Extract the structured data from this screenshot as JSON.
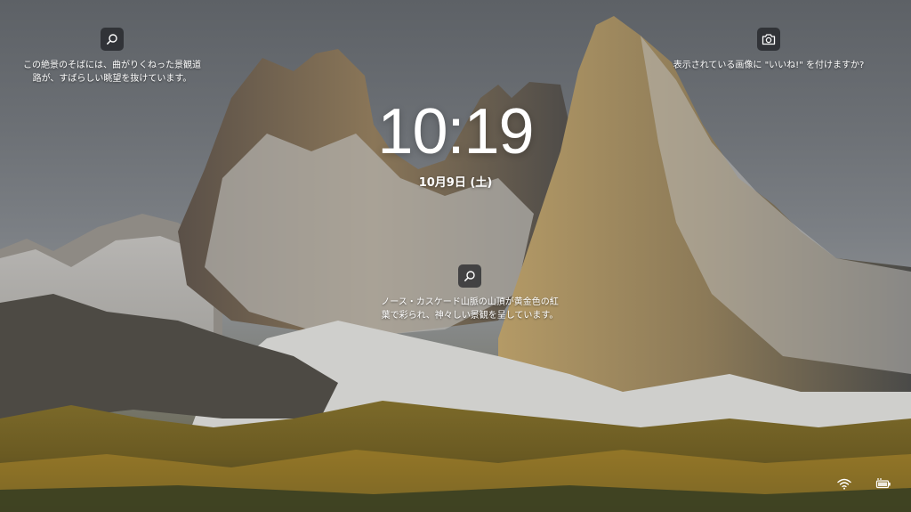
{
  "lockscreen": {
    "time": "10:19",
    "date": "10月9日 (土)"
  },
  "spotlight": {
    "left_caption": "この絶景のそばには、曲がりくねった景観道\n路が、すばらしい眺望を抜けています。",
    "center_caption": "ノース・カスケード山脈の山頂が黄金色の紅\n葉で彩られ、神々しい景観を呈しています。",
    "right_caption": "表示されている画像に \"いいね!\" を付けますか?"
  },
  "icons": {
    "left": "search-icon",
    "center": "search-icon",
    "right": "camera-icon",
    "network": "wifi-icon",
    "battery": "battery-charging-icon"
  },
  "colors": {
    "icon_button_bg": "#1e2024",
    "text": "#ffffff"
  }
}
